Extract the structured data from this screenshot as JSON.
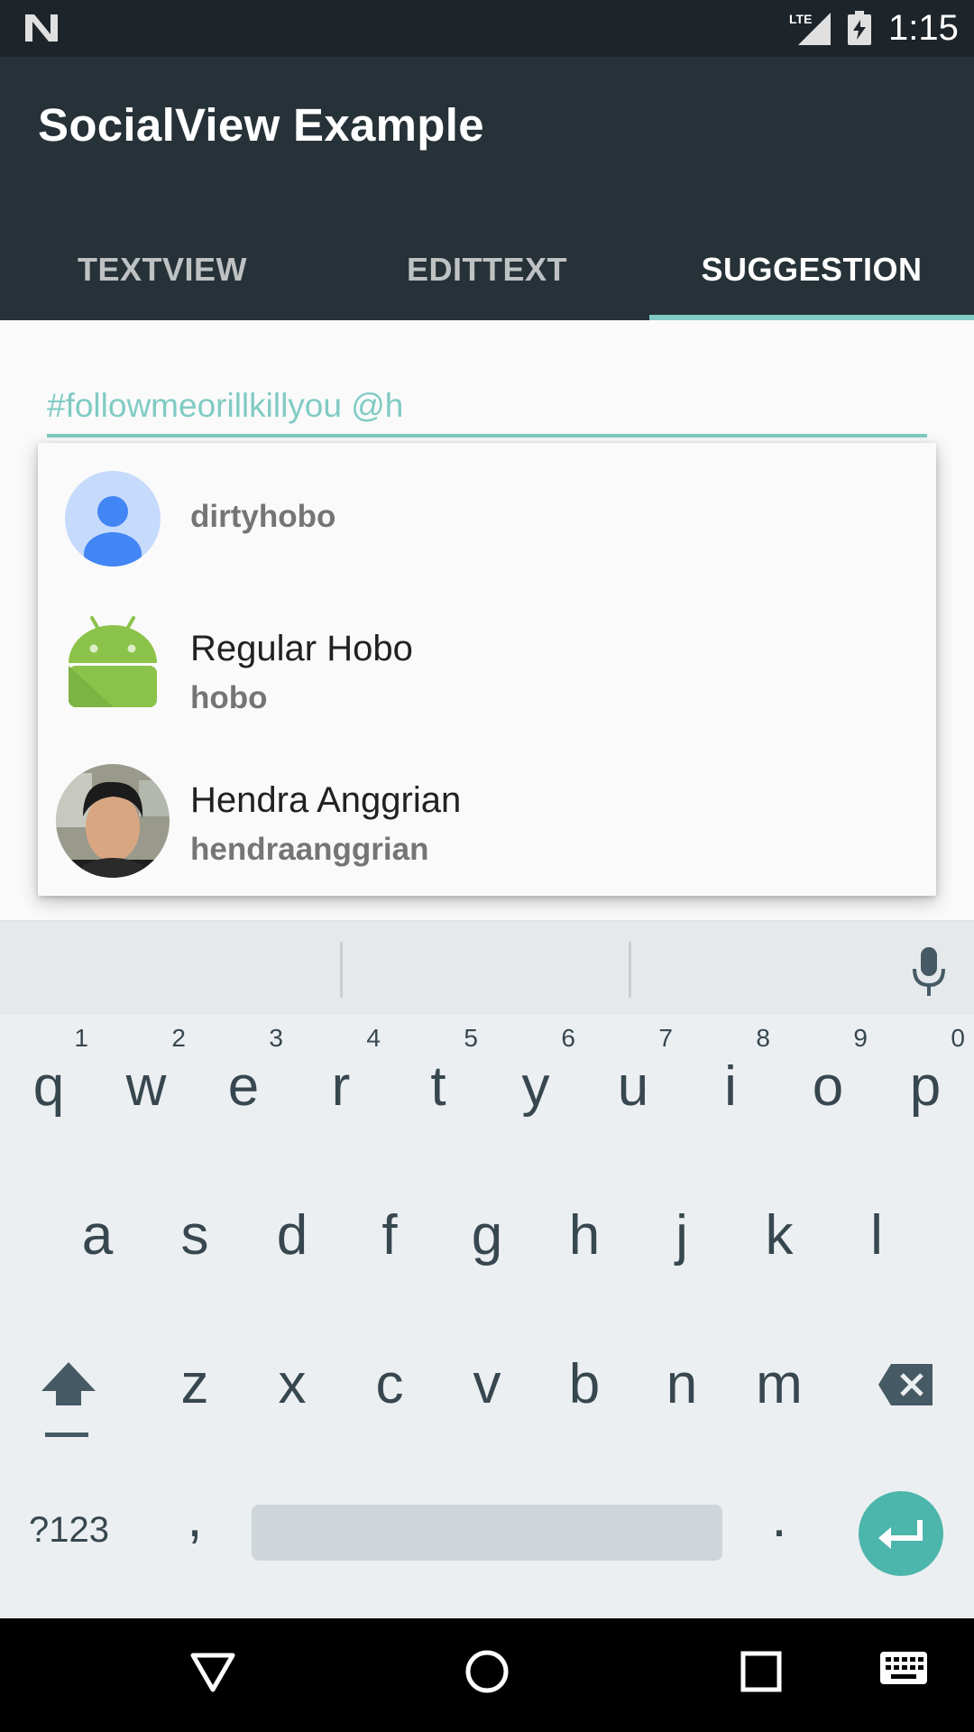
{
  "status_bar": {
    "time": "1:15",
    "network": "LTE",
    "icons": [
      "android-n-logo-icon",
      "lte-signal-icon",
      "battery-icon"
    ]
  },
  "app": {
    "title": "SocialView Example"
  },
  "tabs": [
    {
      "label": "TEXTVIEW",
      "active": false
    },
    {
      "label": "EDITTEXT",
      "active": false
    },
    {
      "label": "SUGGESTION",
      "active": true
    }
  ],
  "input": {
    "value": "#followmeorillkillyou @h"
  },
  "suggestions": [
    {
      "name": "",
      "username": "dirtyhobo",
      "avatar": "default-person-avatar"
    },
    {
      "name": "Regular Hobo",
      "username": "hobo",
      "avatar": "android-robot-avatar"
    },
    {
      "name": "Hendra Anggrian",
      "username": "hendraanggrian",
      "avatar": "photo-avatar"
    }
  ],
  "keyboard": {
    "row1": [
      {
        "key": "q",
        "num": "1"
      },
      {
        "key": "w",
        "num": "2"
      },
      {
        "key": "e",
        "num": "3"
      },
      {
        "key": "r",
        "num": "4"
      },
      {
        "key": "t",
        "num": "5"
      },
      {
        "key": "y",
        "num": "6"
      },
      {
        "key": "u",
        "num": "7"
      },
      {
        "key": "i",
        "num": "8"
      },
      {
        "key": "o",
        "num": "9"
      },
      {
        "key": "p",
        "num": "0"
      }
    ],
    "row2": [
      "a",
      "s",
      "d",
      "f",
      "g",
      "h",
      "j",
      "k",
      "l"
    ],
    "row3": [
      "z",
      "x",
      "c",
      "v",
      "b",
      "n",
      "m"
    ],
    "symbols_label": "?123",
    "comma": ",",
    "period": "."
  },
  "colors": {
    "accent": "#80cbc4",
    "app_bar": "#263238",
    "status_bar": "#1e252a",
    "enter_button": "#4db6ac"
  }
}
